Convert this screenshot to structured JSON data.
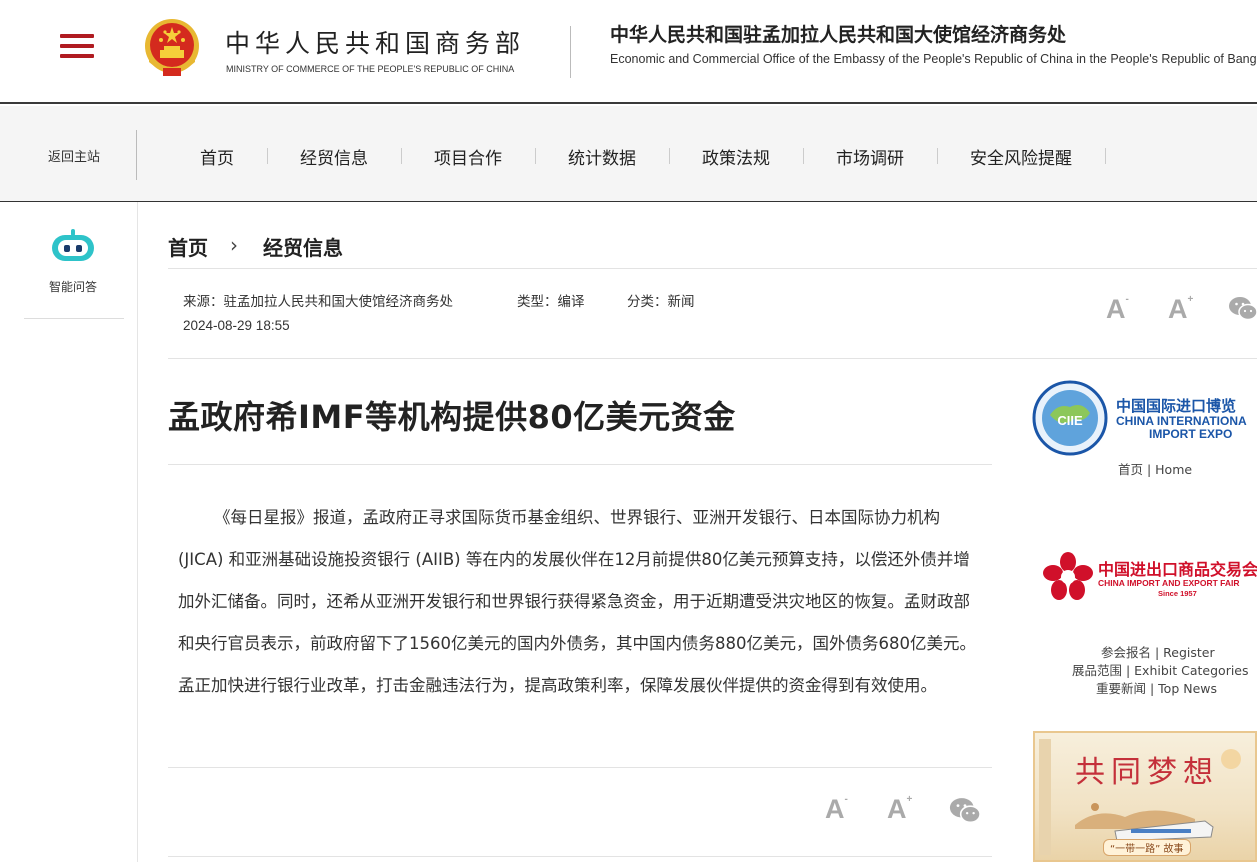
{
  "header": {
    "ministry_cn": "中华人民共和国商务部",
    "ministry_en": "MINISTRY OF COMMERCE OF THE PEOPLE'S REPUBLIC OF CHINA",
    "office_cn": "中华人民共和国驻孟加拉人民共和国大使馆经济商务处",
    "office_en": "Economic and Commercial Office of the Embassy of the People's Republic of China in the People's Republic of Bangladesh"
  },
  "nav": {
    "back": "返回主站",
    "items": [
      "首页",
      "经贸信息",
      "项目合作",
      "统计数据",
      "政策法规",
      "市场调研",
      "安全风险提醒"
    ]
  },
  "sidebar_left": {
    "assistant_label": "智能问答"
  },
  "breadcrumb": {
    "home": "首页",
    "separator": "›",
    "current": "经贸信息"
  },
  "meta": {
    "source": "来源：驻孟加拉人民共和国大使馆经济商务处",
    "type": "类型：编译",
    "category": "分类：新闻",
    "date": "2024-08-29 18:55"
  },
  "font_controls": {
    "small": "A",
    "large": "A",
    "minus": "-",
    "plus": "+"
  },
  "article": {
    "title": "孟政府希IMF等机构提供80亿美元资金",
    "body": "《每日星报》报道，孟政府正寻求国际货币基金组织、世界银行、亚洲开发银行、日本国际协力机构 (JICA) 和亚洲基础设施投资银行 (AIIB) 等在内的发展伙伴在12月前提供80亿美元预算支持，以偿还外债并增加外汇储备。同时，还希从亚洲开发银行和世界银行获得紧急资金，用于近期遭受洪灾地区的恢复。孟财政部和央行官员表示，前政府留下了1560亿美元的国内外债务，其中国内债务880亿美元，国外债务680亿美元。孟正加快进行银行业改革，打击金融违法行为，提高政策利率，保障发展伙伴提供的资金得到有效使用。"
  },
  "sidebar_right": {
    "ciie": {
      "logo_text": "CIIE",
      "name_cn": "中国国际进口博览",
      "name_en1": "CHINA INTERNATIONA",
      "name_en2": "IMPORT EXPO",
      "link": "首页 | Home"
    },
    "canton": {
      "name_cn": "中国进出口商品交易会",
      "name_en": "CHINA IMPORT AND EXPORT FAIR",
      "since": "Since 1957",
      "links": [
        "参会报名 | Register",
        "展品范围 | Exhibit Categories",
        "重要新闻 | Top News"
      ]
    },
    "dream_banner": {
      "title": "共同梦想",
      "subtitle": "“一带一路” 故事"
    }
  },
  "colors": {
    "brand_red": "#b01b21",
    "ciie_blue": "#1b56a8",
    "canton_red": "#d0102a"
  }
}
